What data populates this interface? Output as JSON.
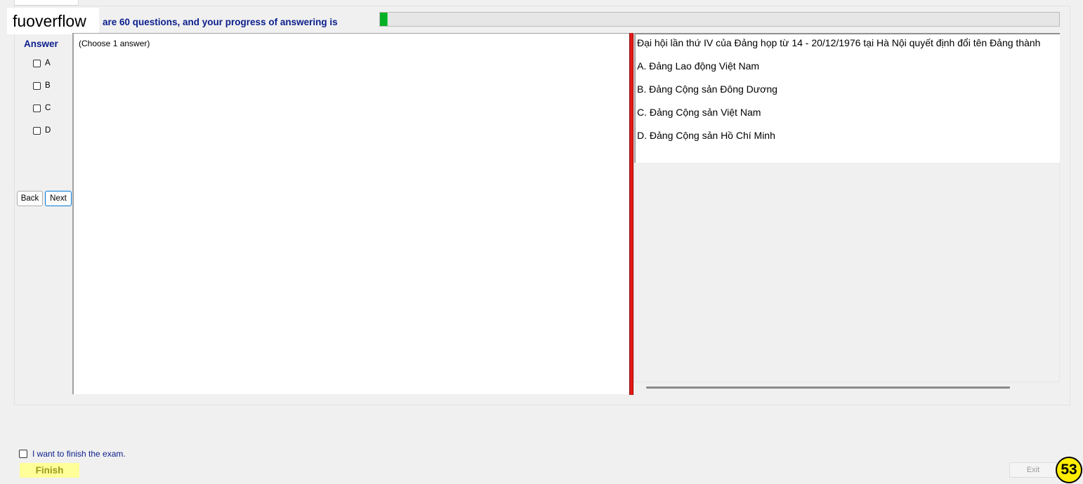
{
  "watermark": "fuoverflow",
  "progress": {
    "label": "are 60 questions, and your progress of answering is",
    "percent": 1
  },
  "answer_panel": {
    "title": "Answer",
    "choices": [
      {
        "label": "A",
        "checked": false
      },
      {
        "label": "B",
        "checked": false
      },
      {
        "label": "C",
        "checked": false
      },
      {
        "label": "D",
        "checked": false
      }
    ],
    "back_label": "Back",
    "next_label": "Next"
  },
  "answer_box": {
    "hint": "(Choose 1 answer)"
  },
  "question": {
    "text": "Đại hội lần thứ IV của Đảng họp từ 14 - 20/12/1976 tại Hà Nội quyết định đổi tên Đảng thành",
    "options": [
      "A.  Đảng Lao động Việt Nam",
      "B.  Đảng Cộng sản Đông Dương",
      "C.  Đảng Cộng sản Việt Nam",
      "D.  Đảng Cộng sản Hồ Chí Minh"
    ]
  },
  "footer": {
    "finish_check_label": "I want to finish the exam.",
    "finish_label": "Finish",
    "exit_label": "Exit",
    "counter": "53"
  },
  "colors": {
    "accent_text": "#0a1e8c",
    "progress_fill": "#06b025",
    "splitter": "#e41b17",
    "finish_bg": "#ffff99",
    "badge": "#ffee00"
  }
}
